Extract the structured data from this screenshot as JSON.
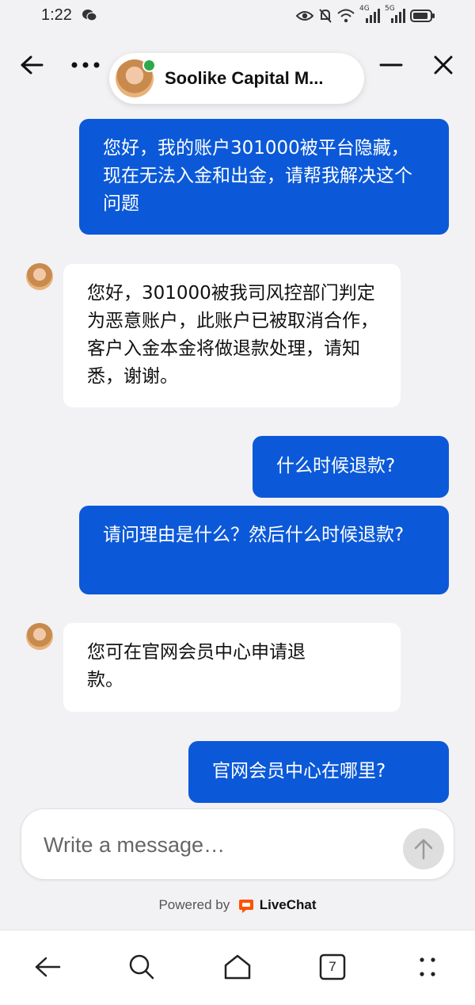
{
  "status_bar": {
    "time": "1:22",
    "icons": [
      "wechat-icon",
      "eye-icon",
      "mute-bell-icon",
      "wifi-icon",
      "signal-4g-icon",
      "signal-5g-icon",
      "battery-icon"
    ],
    "net1": "4G",
    "net2": "5G"
  },
  "header": {
    "agent_name": "Soolike Capital M...",
    "online_color": "#2ea84a"
  },
  "messages": [
    {
      "from": "user",
      "text": "您好，我的账户301000被平台隐藏，现在无法入金和出金，请帮我解决这个问题"
    },
    {
      "from": "agent",
      "text": "您好，301000被我司风控部门判定为恶意账户，此账户已被取消合作，客户入金本金将做退款处理，请知悉，谢谢。"
    },
    {
      "from": "user",
      "text": "什么时候退款?"
    },
    {
      "from": "user",
      "text": "请问理由是什么？然后什么时候退款?"
    },
    {
      "from": "agent",
      "text": "您可在官网会员中心申请退款。"
    },
    {
      "from": "user",
      "text": "官网会员中心在哪里?"
    }
  ],
  "composer": {
    "placeholder": "Write a message…"
  },
  "footer": {
    "powered_by": "Powered by",
    "brand": "LiveChat",
    "brand_color": "#ff5100"
  },
  "nav": {
    "tab_count": "7"
  },
  "colors": {
    "user_bubble": "#0b59d8",
    "agent_bubble": "#ffffff",
    "background": "#f2f2f4"
  }
}
